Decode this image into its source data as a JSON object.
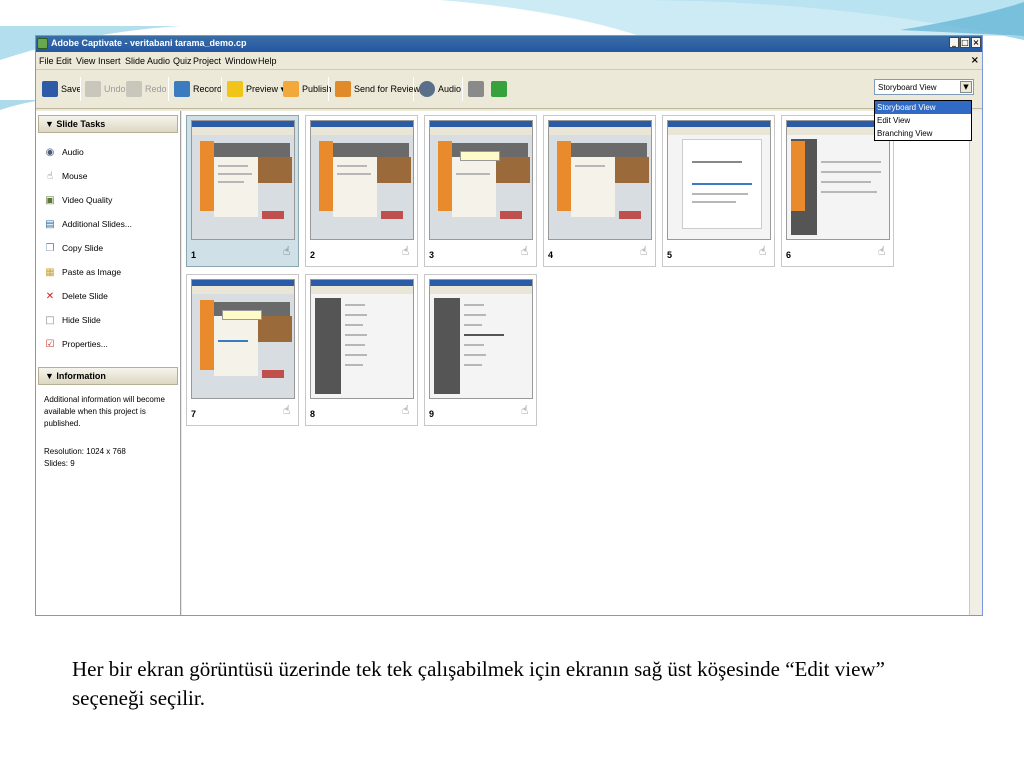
{
  "window": {
    "title": "Adobe Captivate - veritabani tarama_demo.cp",
    "controls": [
      "_",
      "□",
      "×"
    ],
    "menu_close": "×"
  },
  "menu": [
    "File",
    "Edit",
    "View",
    "Insert",
    "Slide",
    "Audio",
    "Quiz",
    "Project",
    "Window",
    "Help"
  ],
  "toolbar": {
    "save": "Save",
    "undo": "Undo",
    "redo": "Redo",
    "record": "Record",
    "preview": "Preview ▾",
    "publish": "Publish",
    "send_for_review": "Send for Review",
    "audio": "Audio"
  },
  "view_selector": {
    "value": "Storyboard View",
    "options": [
      "Storyboard View",
      "Edit View",
      "Branching View"
    ],
    "selected_index": 0
  },
  "slide_tasks": {
    "header": "▼ Slide Tasks",
    "items": [
      "Audio",
      "Mouse",
      "Video Quality",
      "Additional Slides...",
      "Copy Slide",
      "Paste as Image",
      "Delete Slide",
      "Hide Slide",
      "Properties..."
    ]
  },
  "information": {
    "header": "▼ Information",
    "note": "Additional information will become available when this project is published.",
    "resolution": "Resolution: 1024 x 768",
    "slides": "Slides: 9"
  },
  "slides": [
    {
      "number": "1",
      "selected": true,
      "thumb_text": "Select the E-Resources link"
    },
    {
      "number": "2",
      "selected": false,
      "thumb_text": ""
    },
    {
      "number": "3",
      "selected": false,
      "thumb_text": "The METU LIBRARY page appears"
    },
    {
      "number": "4",
      "selected": false,
      "thumb_text": ""
    },
    {
      "number": "5",
      "selected": false,
      "thumb_text": "The METU Library - ELECTRONIC RESOURCES page appears"
    },
    {
      "number": "6",
      "selected": false,
      "thumb_text": ""
    },
    {
      "number": "7",
      "selected": false,
      "thumb_text": "The METU Library - DATABASES A-Z LIST page appears"
    },
    {
      "number": "8",
      "selected": false,
      "thumb_text": ""
    },
    {
      "number": "9",
      "selected": false,
      "thumb_text": "The METU Library - DATABASES A-Z LIST page appears"
    }
  ],
  "mouse_icon": "☝",
  "caption": "Her bir ekran görüntüsü üzerinde tek tek çalışabilmek için ekranın sağ üst köşesinde “Edit  view” seçeneği seçilir.",
  "colors": {
    "titlebar": "#2457a3",
    "selected_slide": "#cfe0e6",
    "dropdown_highlight": "#316ac5",
    "sky": "#7ec8e3"
  }
}
